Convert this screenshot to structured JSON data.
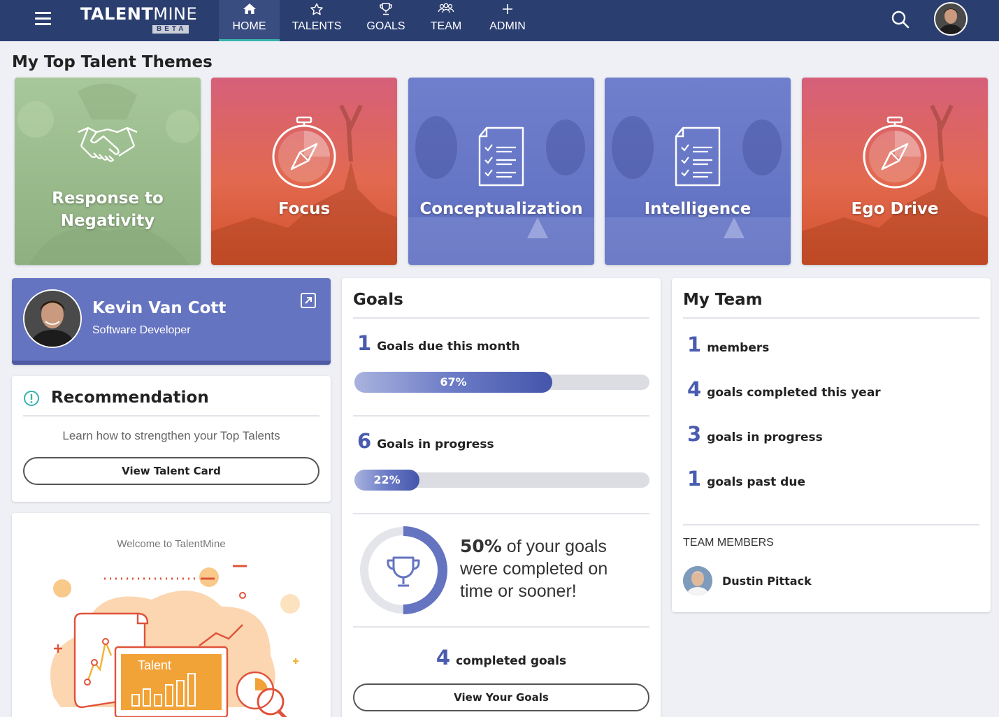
{
  "app": {
    "logo_main": "TALENT",
    "logo_thin": "MINE",
    "logo_badge": "BETA"
  },
  "nav": {
    "items": [
      {
        "label": "HOME",
        "icon": "home-icon",
        "active": true
      },
      {
        "label": "TALENTS",
        "icon": "star-icon"
      },
      {
        "label": "GOALS",
        "icon": "trophy-icon"
      },
      {
        "label": "TEAM",
        "icon": "team-icon"
      },
      {
        "label": "ADMIN",
        "icon": "plus-icon"
      }
    ]
  },
  "top_talents": {
    "title": "My Top Talent Themes",
    "cards": [
      {
        "name": "Response to Negativity",
        "icon": "handshake-icon",
        "color": "#9fc092"
      },
      {
        "name": "Focus",
        "icon": "compass-stopwatch-icon",
        "color": "#dc5f4c"
      },
      {
        "name": "Conceptualization",
        "icon": "checklist-icon",
        "color": "#6b7bc9"
      },
      {
        "name": "Intelligence",
        "icon": "checklist-icon",
        "color": "#6b7bc9"
      },
      {
        "name": "Ego Drive",
        "icon": "compass-stopwatch-icon",
        "color": "#dc5f4c"
      }
    ]
  },
  "profile": {
    "name": "Kevin Van Cott",
    "role": "Software Developer"
  },
  "recommendation": {
    "title": "Recommendation",
    "description": "Learn how to strengthen your Top Talents",
    "button": "View Talent Card"
  },
  "welcome": {
    "text": "Welcome to TalentMine",
    "illustration_label": "Talent"
  },
  "goals": {
    "title": "Goals",
    "due_count": "1",
    "due_label": "Goals due this month",
    "due_progress": 0.67,
    "due_progress_label": "67%",
    "inprogress_count": "6",
    "inprogress_label": "Goals in progress",
    "inprogress_progress": 0.22,
    "inprogress_progress_label": "22%",
    "ontime_pct": "50%",
    "ontime_fraction": 0.5,
    "ontime_text": " of your goals were completed on time or sooner!",
    "completed_count": "4",
    "completed_label": "completed goals",
    "button": "View Your Goals"
  },
  "team": {
    "title": "My Team",
    "stats": [
      {
        "num": "1",
        "label": "members"
      },
      {
        "num": "4",
        "label": "goals completed this year"
      },
      {
        "num": "3",
        "label": "goals in progress"
      },
      {
        "num": "1",
        "label": "goals past due"
      }
    ],
    "members_label": "TEAM MEMBERS",
    "members": [
      {
        "name": "Dustin Pittack"
      }
    ]
  },
  "colors": {
    "nav_bg": "#2b3e70",
    "accent": "#4a5cb0",
    "active_underline": "#38b2ac"
  }
}
